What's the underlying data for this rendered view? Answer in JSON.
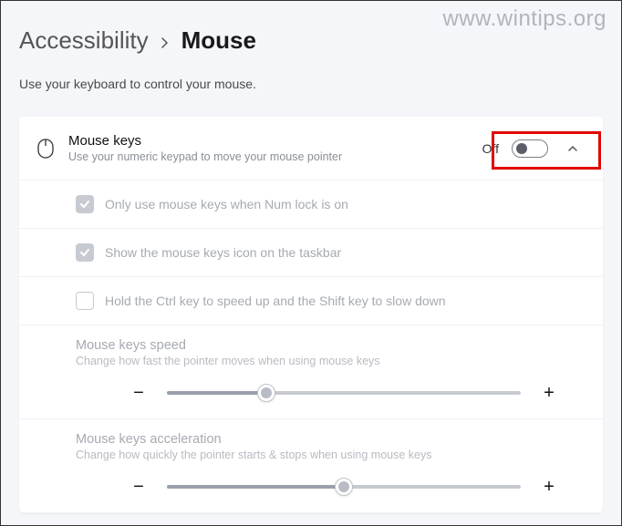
{
  "watermark": "www.wintips.org",
  "breadcrumb": {
    "parent": "Accessibility",
    "current": "Mouse"
  },
  "description": "Use your keyboard to control your mouse.",
  "mouse_keys": {
    "title": "Mouse keys",
    "subtitle": "Use your numeric keypad to move your mouse pointer",
    "toggle_state": "Off"
  },
  "options": {
    "numlock": "Only use mouse keys when Num lock is on",
    "taskbar": "Show the mouse keys icon on the taskbar",
    "ctrlshift": "Hold the Ctrl key to speed up and the Shift key to slow down"
  },
  "speed": {
    "title": "Mouse keys speed",
    "subtitle": "Change how fast the pointer moves when using mouse keys",
    "value_percent": 28
  },
  "accel": {
    "title": "Mouse keys acceleration",
    "subtitle": "Change how quickly the pointer starts & stops when using mouse keys",
    "value_percent": 50
  },
  "glyphs": {
    "minus": "−",
    "plus": "+"
  }
}
